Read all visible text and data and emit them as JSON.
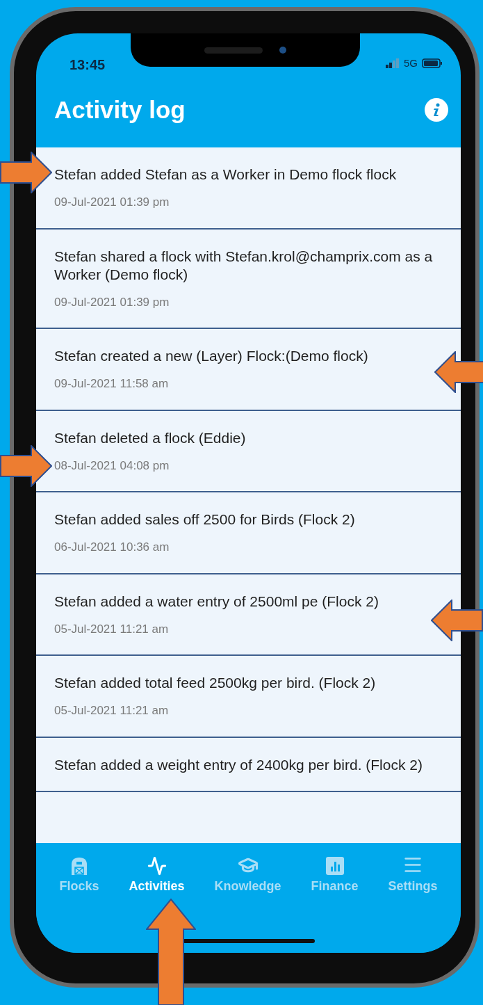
{
  "status_bar": {
    "time": "13:45",
    "network": "5G"
  },
  "header": {
    "title": "Activity log"
  },
  "activities": [
    {
      "text": "Stefan added Stefan as a Worker in Demo flock flock",
      "date": "09-Jul-2021 01:39 pm"
    },
    {
      "text": "Stefan shared a flock with Stefan.krol@champrix.com as a Worker (Demo flock)",
      "date": "09-Jul-2021 01:39 pm"
    },
    {
      "text": "Stefan created a new (Layer) Flock:(Demo flock)",
      "date": "09-Jul-2021 11:58 am"
    },
    {
      "text": "Stefan deleted a flock (Eddie)",
      "date": "08-Jul-2021 04:08 pm"
    },
    {
      "text": "Stefan added sales off 2500 for Birds (Flock 2)",
      "date": "06-Jul-2021 10:36 am"
    },
    {
      "text": "Stefan added a water entry of 2500ml pe (Flock 2)",
      "date": "05-Jul-2021 11:21 am"
    },
    {
      "text": "Stefan added total feed 2500kg per bird. (Flock 2)",
      "date": "05-Jul-2021 11:21 am"
    },
    {
      "text": "Stefan added a weight entry of 2400kg per bird. (Flock 2)"
    }
  ],
  "tab_bar": [
    {
      "kind": "barn",
      "label": "Flocks",
      "selected": false
    },
    {
      "kind": "activity",
      "label": "Activities",
      "selected": true
    },
    {
      "kind": "cap",
      "label": "Knowledge",
      "selected": false
    },
    {
      "kind": "chart",
      "label": "Finance",
      "selected": false
    },
    {
      "kind": "menu",
      "label": "Settings",
      "selected": false
    }
  ]
}
